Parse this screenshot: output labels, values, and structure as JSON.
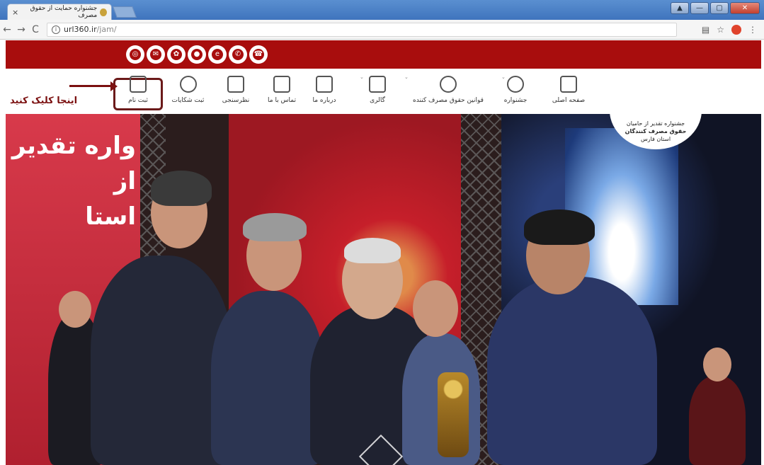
{
  "browser": {
    "tab_title": "جشنواره حمایت از حقوق مصرف",
    "tab_close": "×",
    "url_host": "url360.ir",
    "url_path": "/jam/",
    "nav_back": "←",
    "nav_forward": "→",
    "nav_reload": "C",
    "info_icon": "i",
    "star_icon": "☆"
  },
  "social": {
    "icons": [
      "instagram-icon",
      "email-icon",
      "web-icon",
      "soroush-icon",
      "eitaa-icon",
      "whatsapp-icon",
      "phone-icon"
    ]
  },
  "menu": {
    "items": [
      {
        "label": "صفحه اصلی",
        "icon": "home-icon"
      },
      {
        "label": "جشنواره",
        "icon": "award-icon"
      },
      {
        "label": "قوانین حقوق مصرف کننده",
        "icon": "law-icon"
      },
      {
        "label": "گالری",
        "icon": "gallery-icon"
      },
      {
        "label": "درباره ما",
        "icon": "about-icon"
      },
      {
        "label": "تماس با ما",
        "icon": "contact-icon"
      },
      {
        "label": "نظرسنجی",
        "icon": "survey-icon"
      },
      {
        "label": "ثبت شکایات",
        "icon": "complaints-icon"
      },
      {
        "label": "ثبت نام",
        "icon": "register-icon"
      }
    ],
    "hint": "اینجا کلیک کنید"
  },
  "logo": {
    "line1": "جشنواره تقدیر از حامیان",
    "line2": "حقوق مصرف کنندگان",
    "line3": "استان فارس"
  },
  "hero": {
    "left_banner_text": "واره تقدیر از",
    "left_banner_text2": "استا"
  },
  "colors": {
    "brand_red": "#a80d0d",
    "highlight": "#6b1a1a"
  }
}
